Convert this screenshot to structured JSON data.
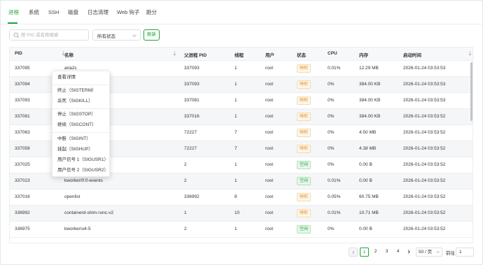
{
  "tabs": [
    "进程",
    "系统",
    "SSH",
    "磁盘",
    "日志清理",
    "Web 钩子",
    "跑分"
  ],
  "toolbar": {
    "search_placeholder": "按 PID 或名称搜索",
    "status_filter": "所有状态",
    "refresh_label": "刷新"
  },
  "table": {
    "columns": [
      "PID",
      "名称",
      "父进程 PID",
      "线程",
      "用户",
      "状态",
      "CPU",
      "内存",
      "启动时间"
    ],
    "rows": [
      {
        "pid": "337095",
        "name": "aria2c",
        "ppid": "337093",
        "threads": "1",
        "user": "root",
        "status": "睡眠",
        "status_kind": "sleep",
        "cpu": "0.01%",
        "mem": "12.29 MB",
        "start": "2026-01-24 03:53:53"
      },
      {
        "pid": "337094",
        "name": "",
        "ppid": "337093",
        "threads": "1",
        "user": "root",
        "status": "睡眠",
        "status_kind": "sleep",
        "cpu": "0%",
        "mem": "384.00 KB",
        "start": "2026-01-24 03:53:53"
      },
      {
        "pid": "337093",
        "name": "",
        "ppid": "337081",
        "threads": "1",
        "user": "root",
        "status": "睡眠",
        "status_kind": "sleep",
        "cpu": "0%",
        "mem": "384.00 KB",
        "start": "2026-01-24 03:53:53"
      },
      {
        "pid": "337081",
        "name": "",
        "ppid": "337016",
        "threads": "1",
        "user": "root",
        "status": "睡眠",
        "status_kind": "sleep",
        "cpu": "0%",
        "mem": "384.00 KB",
        "start": "2026-01-24 03:53:52"
      },
      {
        "pid": "337063",
        "name": "",
        "ppid": "72227",
        "threads": "7",
        "user": "root",
        "status": "睡眠",
        "status_kind": "sleep",
        "cpu": "0%",
        "mem": "4.50 MB",
        "start": "2026-01-24 03:53:52"
      },
      {
        "pid": "337058",
        "name": "",
        "ppid": "72227",
        "threads": "7",
        "user": "root",
        "status": "睡眠",
        "status_kind": "sleep",
        "cpu": "0%",
        "mem": "4.38 MB",
        "start": "2026-01-24 03:53:52"
      },
      {
        "pid": "337025",
        "name": "",
        "ppid": "2",
        "threads": "1",
        "user": "root",
        "status": "空闲",
        "status_kind": "idle",
        "cpu": "0%",
        "mem": "0.00 B",
        "start": "2026-01-24 03:53:52"
      },
      {
        "pid": "337023",
        "name": "kworker/0:0-events",
        "ppid": "2",
        "threads": "1",
        "user": "root",
        "status": "空闲",
        "status_kind": "idle",
        "cpu": "0.01%",
        "mem": "0.00 B",
        "start": "2026-01-24 03:53:52"
      },
      {
        "pid": "337016",
        "name": "openlist",
        "ppid": "336992",
        "threads": "8",
        "user": "root",
        "status": "睡眠",
        "status_kind": "sleep",
        "cpu": "0.05%",
        "mem": "60.75 MB",
        "start": "2026-01-24 03:53:52"
      },
      {
        "pid": "336992",
        "name": "containerd-shim-runc-v2",
        "ppid": "1",
        "threads": "10",
        "user": "root",
        "status": "睡眠",
        "status_kind": "sleep",
        "cpu": "0.01%",
        "mem": "10.71 MB",
        "start": "2026-01-24 03:53:52"
      },
      {
        "pid": "336975",
        "name": "kworker/u4-5",
        "ppid": "2",
        "threads": "1",
        "user": "root",
        "status": "空闲",
        "status_kind": "idle",
        "cpu": "0%",
        "mem": "0.00 B",
        "start": "2026-01-24 03:53:52"
      }
    ]
  },
  "context_menu": {
    "items": [
      "查看详情",
      "终止（SIGTERM）",
      "杀死（SIGKILL）",
      "停止（SIGSTOP）",
      "继续（SIGCONT）",
      "中断（SIGINT）",
      "挂起（SIGHUP）",
      "用户信号 1（SIGUSR1）",
      "用户信号 2（SIGUSR2）"
    ]
  },
  "pagination": {
    "pages": [
      "1",
      "2",
      "3",
      "4"
    ],
    "current": "1",
    "page_size": "50 / 页",
    "goto_label": "前往",
    "goto_value": "1"
  },
  "colors": {
    "accent": "#20a53a",
    "sleep_badge": "#e6a23c",
    "idle_badge": "#20a53a"
  }
}
